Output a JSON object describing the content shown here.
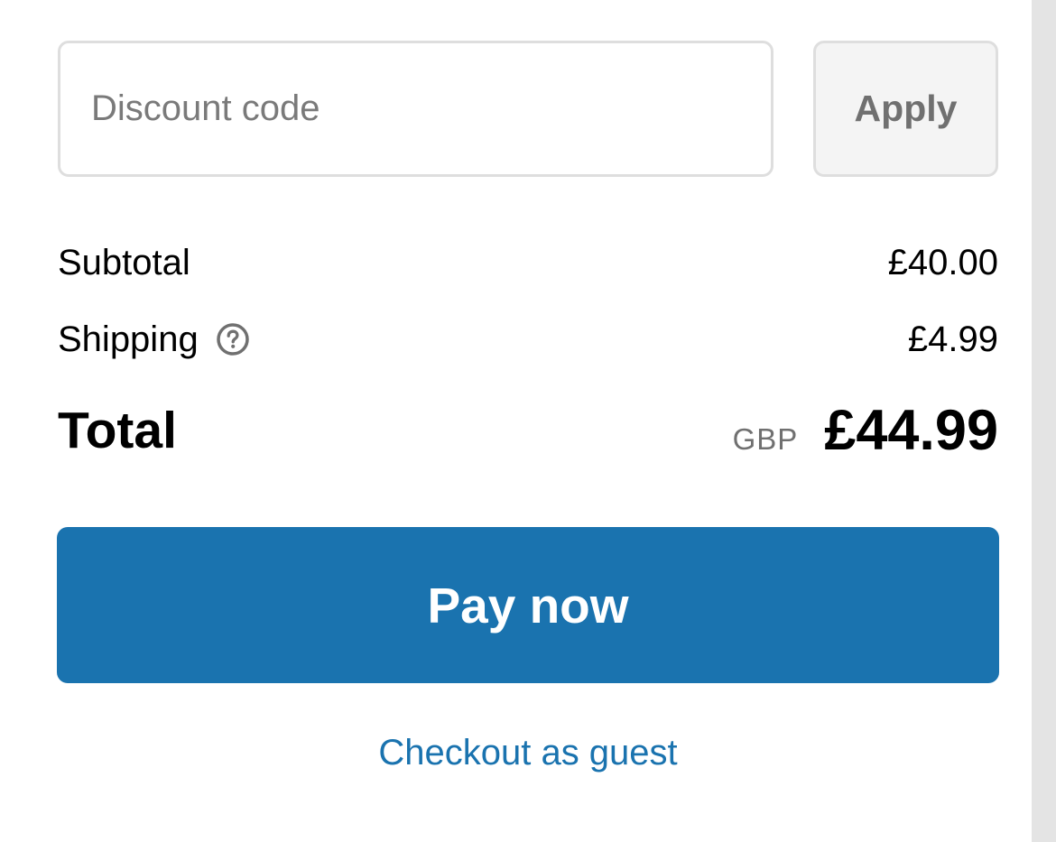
{
  "discount": {
    "placeholder": "Discount code",
    "value": "",
    "apply_label": "Apply"
  },
  "summary": {
    "subtotal_label": "Subtotal",
    "subtotal_amount": "£40.00",
    "shipping_label": "Shipping",
    "shipping_help_icon": "question-circle-icon",
    "shipping_amount": "£4.99",
    "total_label": "Total",
    "total_currency": "GBP",
    "total_amount": "£44.99"
  },
  "actions": {
    "pay_label": "Pay now",
    "guest_label": "Checkout as guest"
  },
  "colors": {
    "accent": "#1a73af",
    "border": "#dedede",
    "muted_text": "#707070"
  }
}
